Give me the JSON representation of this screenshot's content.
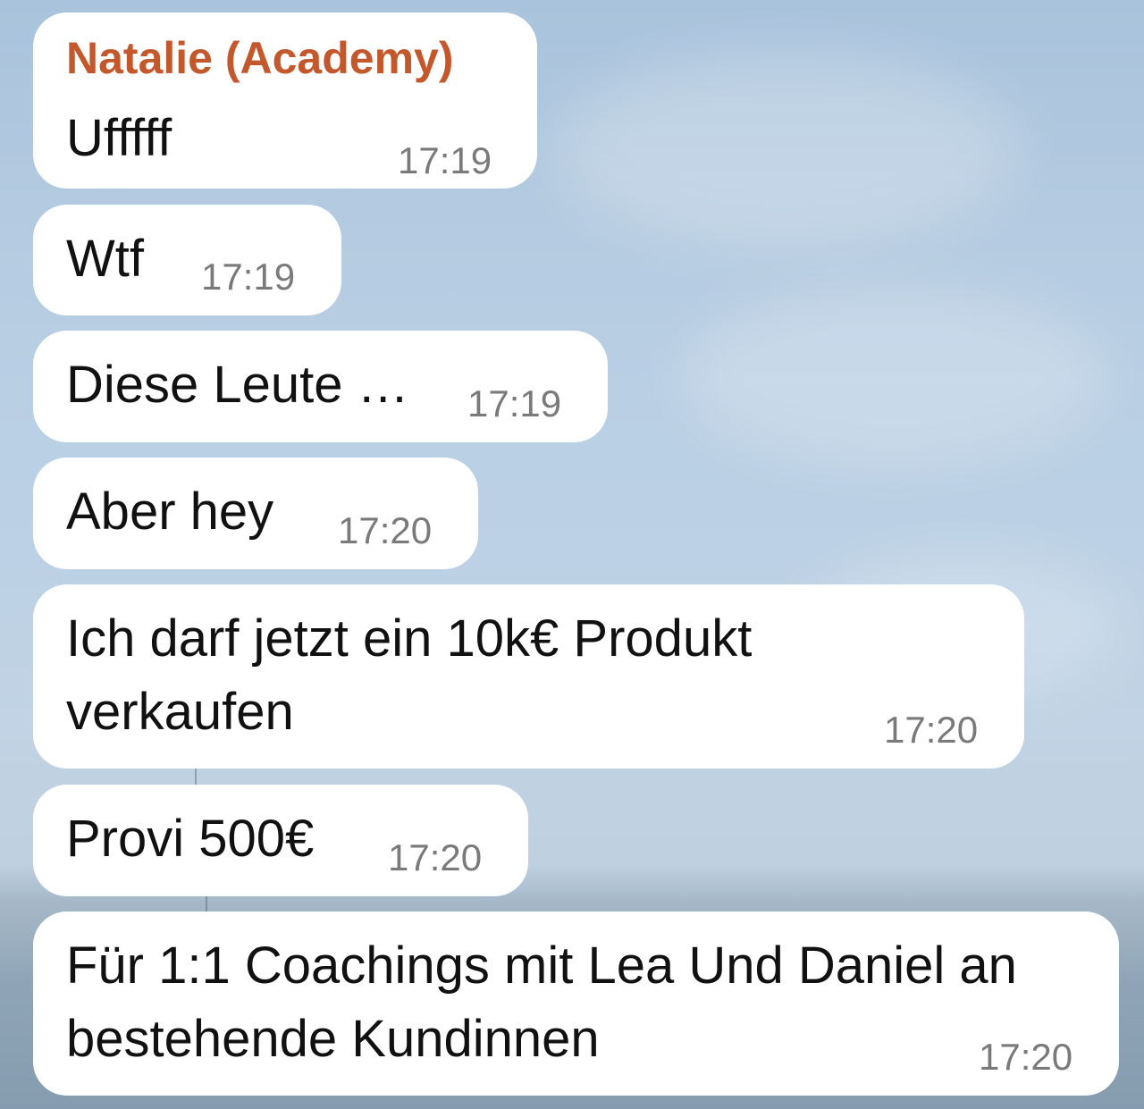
{
  "chat": {
    "sender_name": "Natalie (Academy)",
    "sender_color": "#c4582d",
    "messages": [
      {
        "lines": [
          "Ufffff"
        ],
        "time": "17:19"
      },
      {
        "lines": [
          "Wtf"
        ],
        "time": "17:19"
      },
      {
        "lines": [
          "Diese Leute …"
        ],
        "time": "17:19"
      },
      {
        "lines": [
          "Aber hey"
        ],
        "time": "17:20"
      },
      {
        "lines": [
          "Ich darf jetzt ein 10k€ Produkt",
          "verkaufen"
        ],
        "time": "17:20"
      },
      {
        "lines": [
          "Provi 500€"
        ],
        "time": "17:20"
      },
      {
        "lines": [
          "Für 1:1 Coachings mit Lea Und Daniel an",
          "bestehende Kundinnen"
        ],
        "time": "17:20"
      }
    ]
  }
}
